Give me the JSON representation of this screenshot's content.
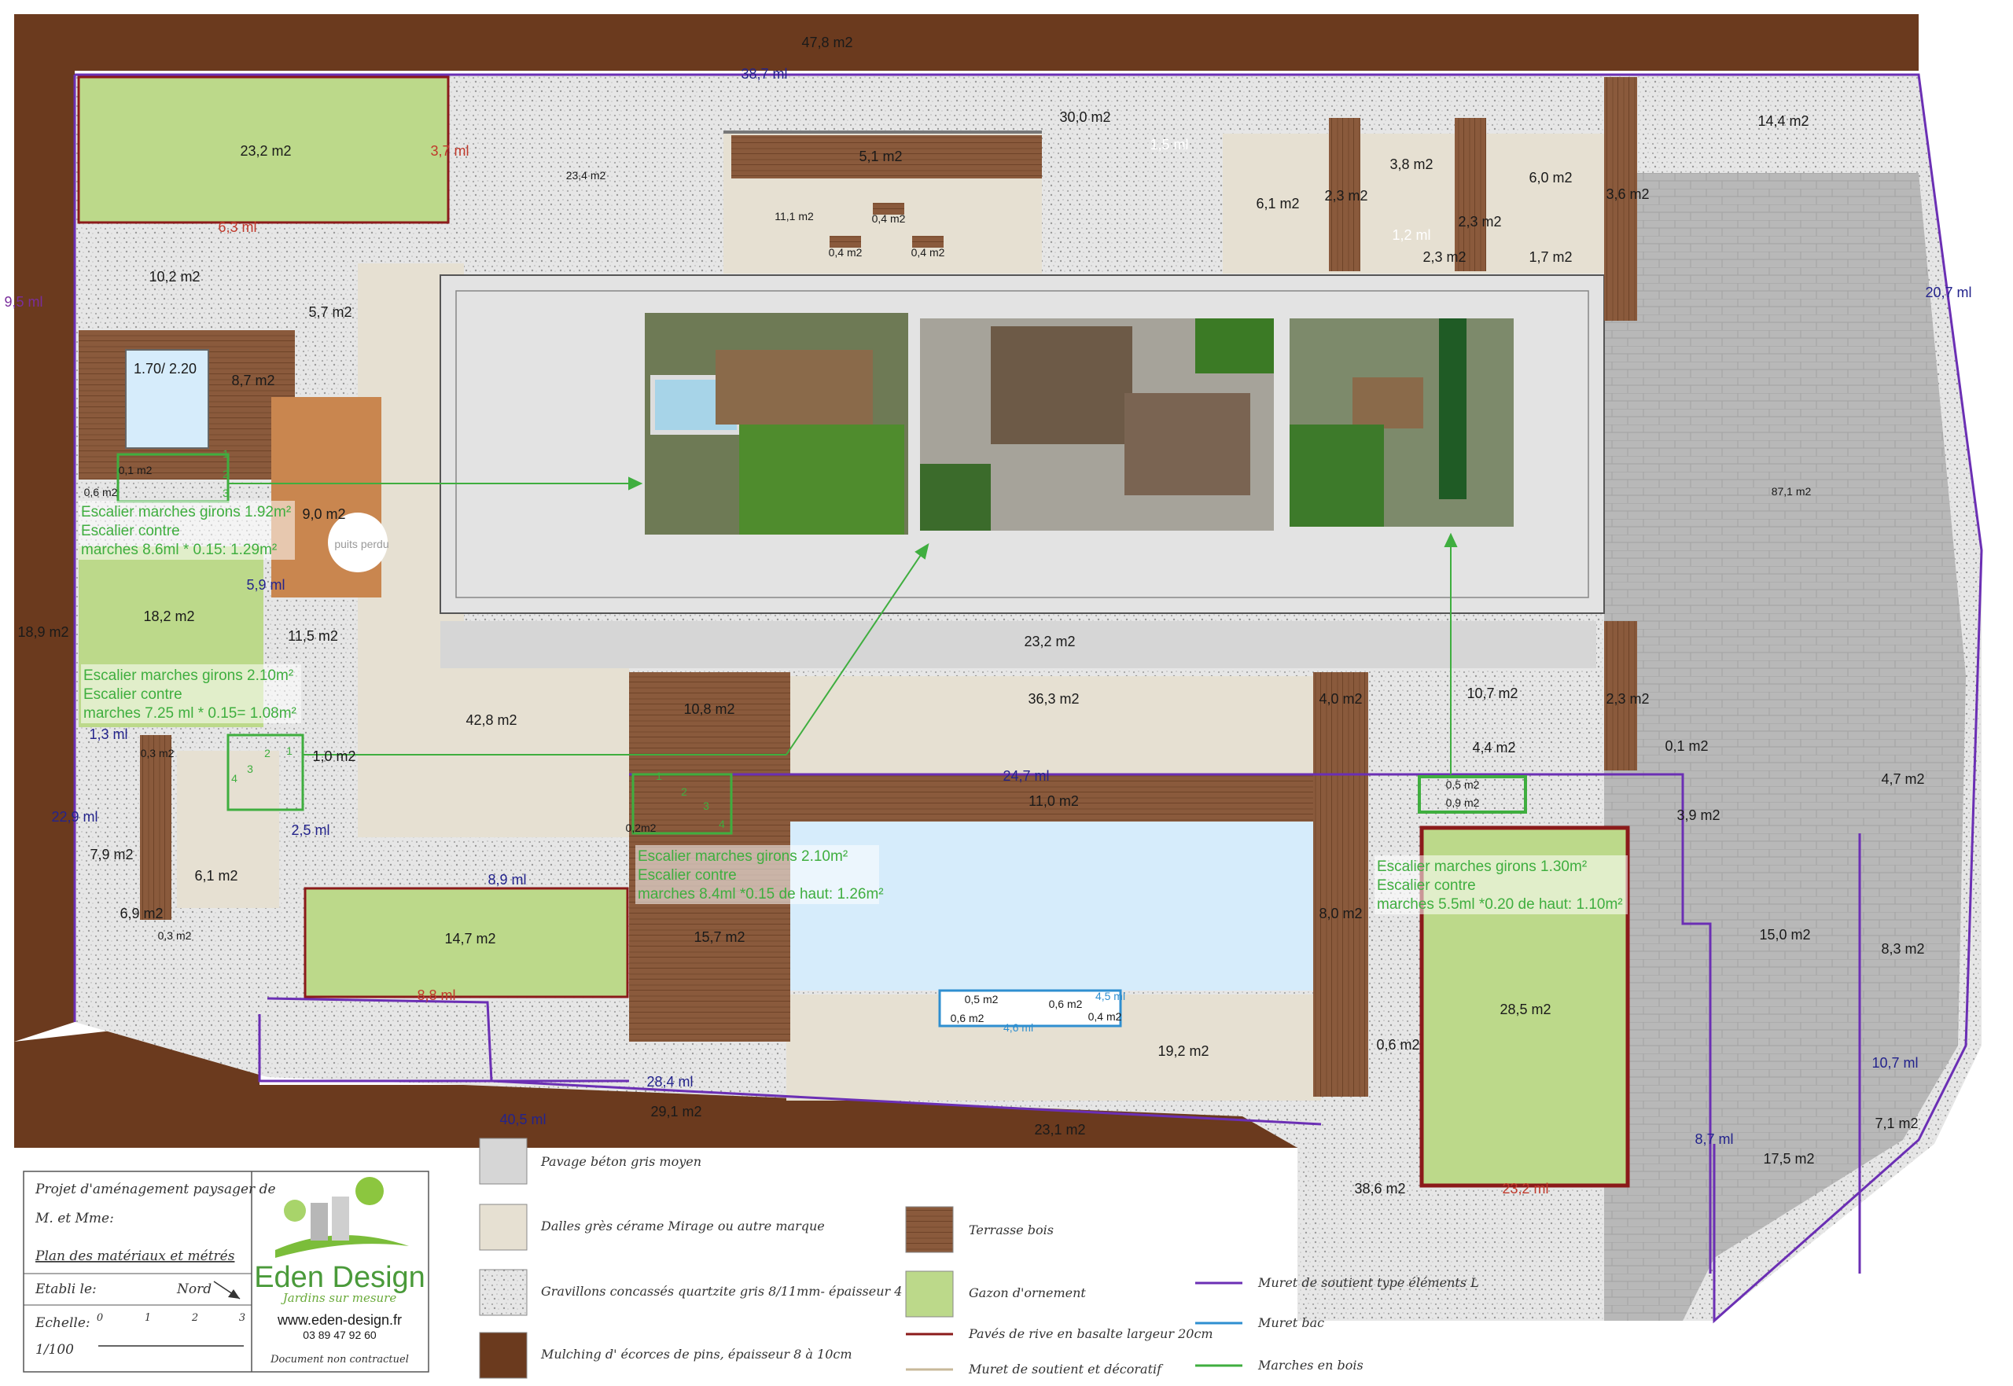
{
  "colors": {
    "mulch": "#6b3a1e",
    "gravel": "#e4e4e4",
    "concrete": "#d6d6d6",
    "tile": "#e6e0d2",
    "wood": "#8a5a3c",
    "lawn": "#bcd98a",
    "water": "#d6ecfb",
    "wall_purple": "#6b2fb4",
    "wall_blue": "#2f8fd0",
    "border_red": "#8b1a1a",
    "steps_green": "#3fae3f",
    "paving_grey": "#b8b8b8"
  },
  "areas": [
    "47,8 m2",
    "23,2 m2",
    "23,4 m2",
    "30,0 m2",
    "5,1 m2",
    "11,1 m2",
    "0,4 m2",
    "0,4 m2",
    "0,4 m2",
    "6,1 m2",
    "3,8 m2",
    "6,0 m2",
    "2,3 m2",
    "2,3 m2",
    "2,3 m2",
    "1,7 m2",
    "3,6 m2",
    "14,4 m2",
    "10,2 m2",
    "5,7 m2",
    "1.70/ 2.20",
    "8,7 m2",
    "0,1 m2",
    "0,6 m2",
    "9,0 m2",
    "18,2 m2",
    "18,9 m2",
    "11,5 m2",
    "42,8 m2",
    "23,2 m2",
    "87,1 m2",
    "10,8 m2",
    "36,3 m2",
    "4,0 m2",
    "10,7 m2",
    "2,3 m2",
    "4,4 m2",
    "0,1 m2",
    "4,7 m2",
    "0,3 m2",
    "1,0 m2",
    "11,0 m2",
    "0,2m2",
    "3,9 m2",
    "0,5 m2",
    "0,9 m2",
    "7,9 m2",
    "6,1 m2",
    "6,9 m2",
    "0,3 m2",
    "14,7 m2",
    "15,7 m2",
    "8,0 m2",
    "28,5 m2",
    "15,0 m2",
    "8,3 m2",
    "0,5 m2",
    "0,6 m2",
    "0,6 m2",
    "0,4 m2",
    "19,2 m2",
    "0,6 m2",
    "29,1 m2",
    "23,1 m2",
    "38,6 m2",
    "17,5 m2",
    "7,1 m2"
  ],
  "lengths": [
    "38,7 ml",
    "3,7 ml",
    "6,3 ml",
    "9,5 ml",
    "20,7 ml",
    "5,9 ml",
    "1,3 ml",
    "22,9 ml",
    "2,5 ml",
    "8,9 ml",
    "24,7 ml",
    "8,8 ml",
    "28,4 ml",
    "40,5 ml",
    "8,7 ml",
    "23,2 ml",
    "10,7 ml",
    "1,5 ml",
    "1,2 ml",
    "4,5 ml",
    "4,6 ml"
  ],
  "labels": {
    "puits": "puits perdu"
  },
  "notes": [
    [
      "Escalier marches girons 1.92m²",
      "Escalier contre",
      "marches 8.6ml * 0.15: 1.29m²"
    ],
    [
      "Escalier marches girons 2.10m²",
      "Escalier contre",
      "marches 7.25 ml * 0.15= 1.08m²"
    ],
    [
      "Escalier marches girons 2.10m²",
      "Escalier contre",
      "marches 8.4ml *0.15 de haut: 1.26m²"
    ],
    [
      "Escalier marches girons 1.30m²",
      "Escalier contre",
      "marches 5.5ml *0.20 de haut: 1.10m²"
    ]
  ],
  "step_numbers": [
    "1",
    "2",
    "3",
    "4"
  ],
  "legend": {
    "items": [
      "Pavage béton gris moyen",
      "Dalles grès cérame Mirage ou autre marque",
      "Gravillons concassés quartzite gris 8/11mm- épaisseur 4 à 5 cm",
      "Mulching d' écorces de pins, épaisseur 8 à 10cm",
      "Terrasse bois",
      "Gazon d'ornement",
      "Pavés de rive en basalte largeur 20cm",
      "Muret de soutient et décoratif",
      "Muret de soutient type éléments L",
      "Muret bac",
      "Marches en bois"
    ]
  },
  "title_block": {
    "project_line1": "Projet d'aménagement paysager de",
    "project_line2": "M. et Mme:",
    "plan": "Plan des matériaux et métrés",
    "etabli": "Etabli le:",
    "nord": "Nord",
    "echelle": "Echelle:",
    "scale_ratio": "1/100",
    "ticks": [
      "0",
      "1",
      "2",
      "3"
    ],
    "logo": "Eden Design",
    "tagline": "Jardins sur mesure",
    "website": "www.eden-design.fr",
    "phone": "03 89 47 92 60",
    "disclaimer": "Document non contractuel"
  }
}
